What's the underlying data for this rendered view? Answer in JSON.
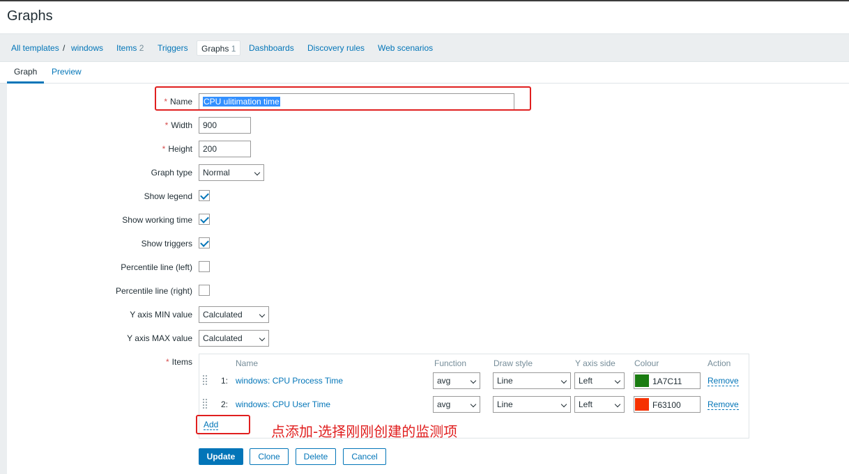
{
  "page": {
    "title": "Graphs"
  },
  "breadcrumbs": {
    "all_templates": "All templates",
    "separator": "/",
    "template": "windows",
    "items": "Items",
    "items_count": "2",
    "triggers": "Triggers",
    "graphs": "Graphs",
    "graphs_count": "1",
    "dashboards": "Dashboards",
    "discovery": "Discovery rules",
    "web": "Web scenarios"
  },
  "tabs": {
    "graph": "Graph",
    "preview": "Preview"
  },
  "form": {
    "required_mark": "*",
    "name_label": "Name",
    "name_value": "CPU ulitimation time",
    "width_label": "Width",
    "width_value": "900",
    "height_label": "Height",
    "height_value": "200",
    "graph_type_label": "Graph type",
    "graph_type_value": "Normal",
    "show_legend_label": "Show legend",
    "show_legend": true,
    "show_working_time_label": "Show working time",
    "show_working_time": true,
    "show_triggers_label": "Show triggers",
    "show_triggers": true,
    "percentile_left_label": "Percentile line (left)",
    "percentile_left": false,
    "percentile_right_label": "Percentile line (right)",
    "percentile_right": false,
    "ymin_label": "Y axis MIN value",
    "ymin_value": "Calculated",
    "ymax_label": "Y axis MAX value",
    "ymax_value": "Calculated",
    "items_label": "Items"
  },
  "items_table": {
    "headers": {
      "name": "Name",
      "function": "Function",
      "draw_style": "Draw style",
      "y_axis_side": "Y axis side",
      "colour": "Colour",
      "action": "Action"
    },
    "rows": [
      {
        "num": "1:",
        "name": "windows: CPU Process Time",
        "function": "avg",
        "draw_style": "Line",
        "y_axis_side": "Left",
        "colour": "1A7C11",
        "colour_hex": "#1A7C11",
        "action": "Remove"
      },
      {
        "num": "2:",
        "name": "windows: CPU User Time",
        "function": "avg",
        "draw_style": "Line",
        "y_axis_side": "Left",
        "colour": "F63100",
        "colour_hex": "#F63100",
        "action": "Remove"
      }
    ],
    "add_label": "Add"
  },
  "buttons": {
    "update": "Update",
    "clone": "Clone",
    "delete": "Delete",
    "cancel": "Cancel"
  },
  "annotation": {
    "text": "点添加-选择刚刚创建的监测项",
    "color": "#e01f1f"
  },
  "colors": {
    "accent": "#0275b8",
    "required": "#d64e4e",
    "annotation_box": "#e01f1f"
  }
}
